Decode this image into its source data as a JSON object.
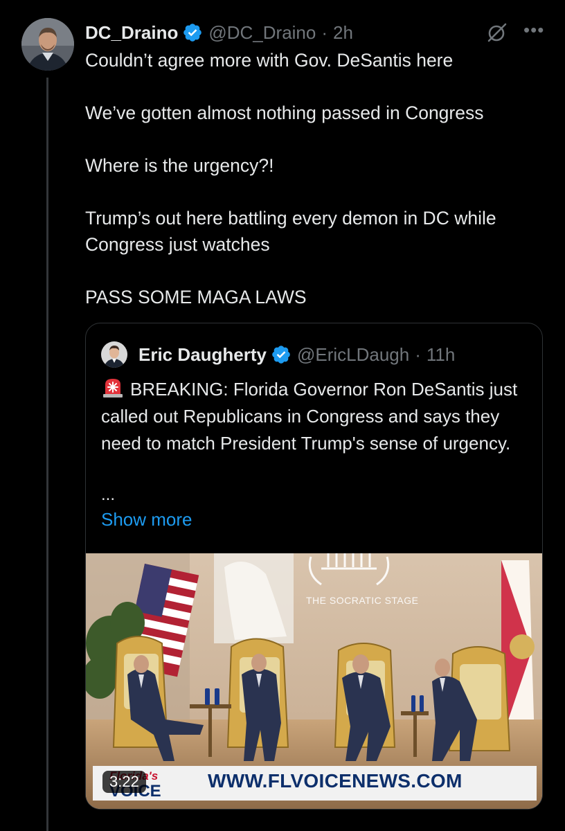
{
  "tweet": {
    "author_name": "DC_Draino",
    "handle": "@DC_Draino",
    "separator": "·",
    "time": "2h",
    "paragraphs": [
      "Couldn’t agree more with Gov. DeSantis here",
      "We’ve gotten almost nothing passed in Congress",
      "Where is the urgency?!",
      "Trump’s out here battling every demon in DC while Congress just watches",
      "PASS SOME MAGA LAWS"
    ]
  },
  "quote": {
    "author_name": "Eric Daugherty",
    "handle": "@EricLDaugh",
    "separator": "·",
    "time": "11h",
    "body": "BREAKING: Florida Governor Ron DeSantis just called out Republicans in Congress and says they need to match President Trump's sense of urgency.",
    "ellipsis": "...",
    "show_more": "Show more",
    "video": {
      "stage_title": "THE SOCRATIC STAGE",
      "duration": "3:22",
      "banner_url": "WWW.FLVOICENEWS.COM",
      "logo_text_top": "Florida's",
      "logo_text_bottom": "VOICE"
    }
  },
  "icons": {
    "verified": "verified-badge-icon",
    "grok": "grok-icon",
    "more": "more-options-icon",
    "siren": "rotating-light-emoji-icon"
  },
  "colors": {
    "background": "#000000",
    "text": "#e7e9ea",
    "muted": "#71767b",
    "link": "#1d9bf0",
    "verified": "#1d9bf0",
    "border": "#2f3336"
  }
}
